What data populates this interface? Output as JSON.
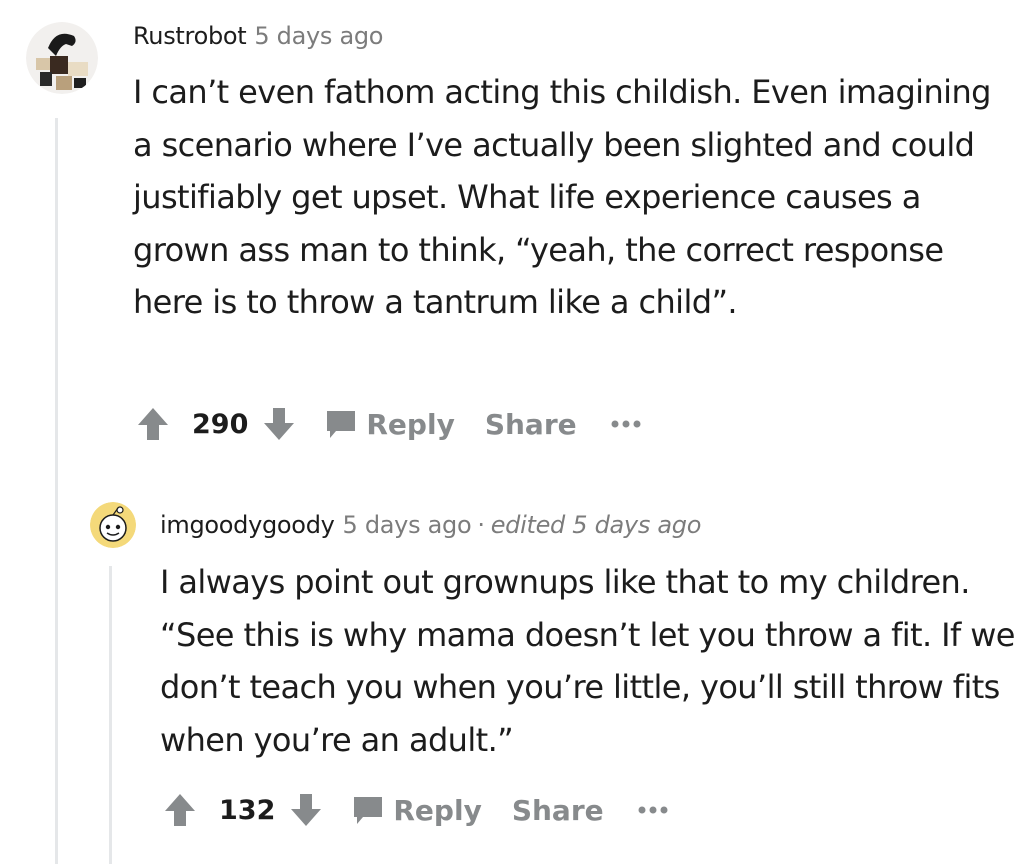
{
  "comments": [
    {
      "author": "Rustrobot",
      "time": "5 days ago",
      "body": "I can’t even fathom acting this childish. Even imagining a scenario where I’ve actually been slighted and could justifiably get upset. What life experience causes a grown ass man to think, “yeah, the correct response here is to throw a tantrum like a child”.",
      "score": "290",
      "reply_label": "Reply",
      "share_label": "Share",
      "avatar_icon": "user-avatar-icon"
    },
    {
      "author": "imgoodygoody",
      "time": "5 days ago",
      "separator": "·",
      "edited": "edited 5 days ago",
      "body": "I always point out grownups like that to my children. “See this is why mama doesn’t let you throw a fit. If we don’t teach you when you’re little, you’ll still throw fits when you’re an adult.”",
      "score": "132",
      "reply_label": "Reply",
      "share_label": "Share",
      "avatar_icon": "snoo-avatar-icon"
    }
  ],
  "colors": {
    "meta_gray": "#7c7c7c",
    "action_gray": "#878a8c",
    "text": "#1c1c1c",
    "thread_line": "#e5e7e9"
  }
}
